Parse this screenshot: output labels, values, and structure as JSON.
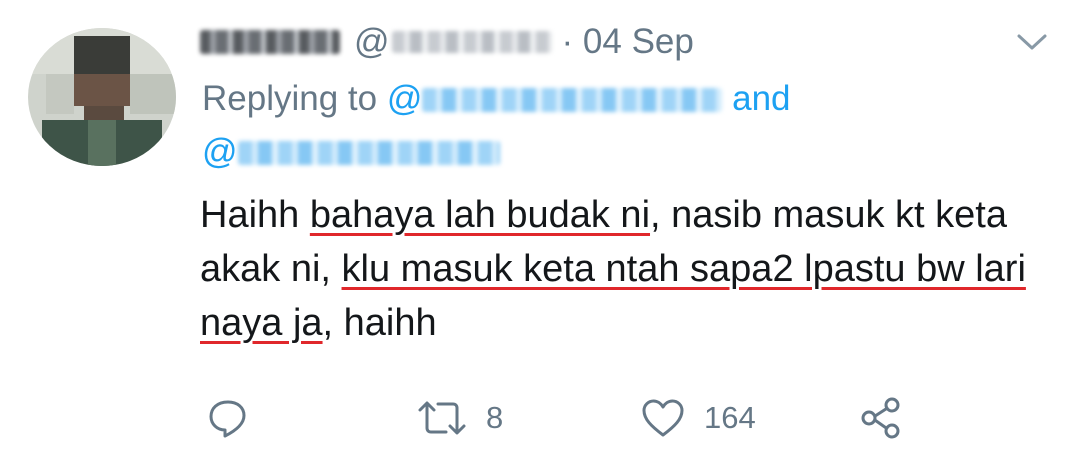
{
  "tweet": {
    "handle_prefix": "@",
    "date": "· 04 Sep",
    "replying_label": "Replying to",
    "reply_at_1": "@",
    "and_label": "and",
    "reply_at_2": "@",
    "body_parts": {
      "p1": "Haihh ",
      "p2": "bahaya lah budak ni",
      "p3": ", nasib masuk kt keta akak ni, ",
      "p4": "klu masuk keta ntah sapa2 lpastu bw lari naya ja",
      "p5": ", haihh"
    }
  },
  "actions": {
    "reply_icon": "reply-icon",
    "retweet_icon": "retweet-icon",
    "retweet_count": "8",
    "like_icon": "heart-icon",
    "like_count": "164",
    "share_icon": "share-icon"
  },
  "colors": {
    "link": "#1da1f2",
    "secondary": "#657786",
    "text": "#14171a",
    "underline": "#e0272b"
  }
}
